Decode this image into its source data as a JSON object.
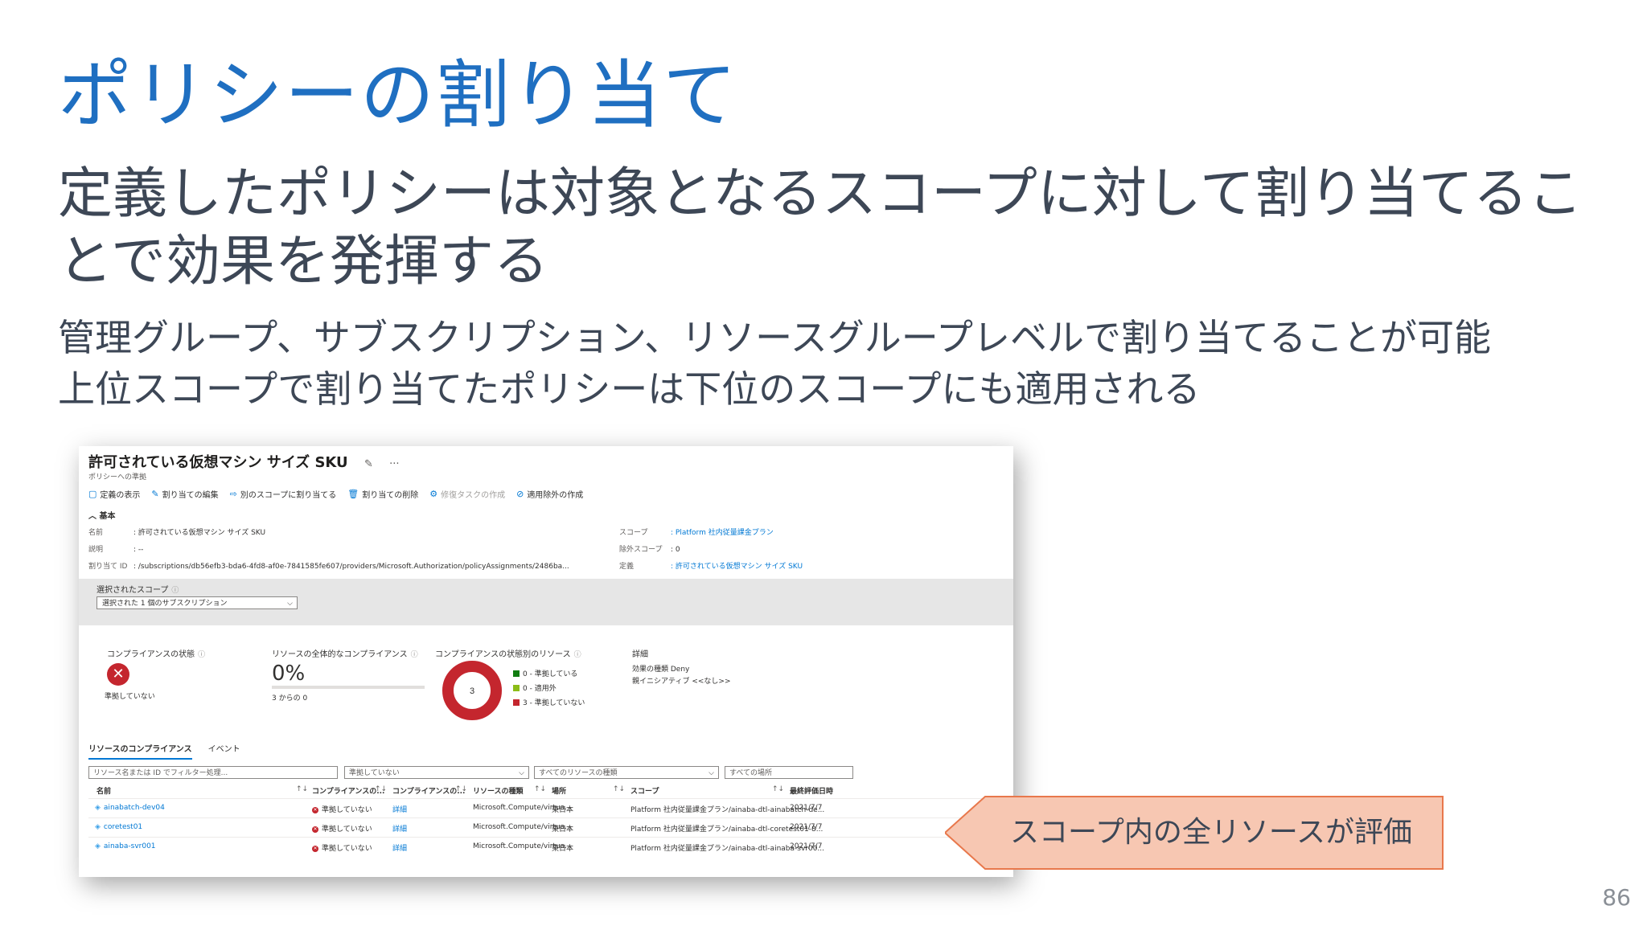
{
  "slide": {
    "title": "ポリシーの割り当て",
    "lead": "定義したポリシーは対象となるスコープに対して割り当てることで効果を発揮する",
    "bullet1": "管理グループ、サブスクリプション、リソースグループレベルで割り当てることが可能",
    "bullet2": "上位スコープで割り当てたポリシーは下位のスコープにも適用される",
    "page_number": "86",
    "callout": "スコープ内の全リソースが評価"
  },
  "panel": {
    "title": "許可されている仮想マシン サイズ SKU",
    "subtitle": "ポリシーへの準拠",
    "toolbar": [
      "定義の表示",
      "割り当ての編集",
      "別のスコープに割り当てる",
      "割り当ての削除",
      "修復タスクの作成",
      "適用除外の作成"
    ],
    "essentials_label": "基本",
    "name_key": "名前",
    "name_val": ": 許可されている仮想マシン サイズ SKU",
    "desc_key": "説明",
    "desc_val": ": --",
    "assign_key": "割り当て ID",
    "assign_val": ": /subscriptions/db56efb3-bda6-4fd8-af0e-7841585fe607/providers/Microsoft.Authorization/policyAssignments/2486ba...",
    "scope_key": "スコープ",
    "scope_val": ": Platform 社内従量課金プラン",
    "excl_key": "除外スコープ",
    "excl_val": ": 0",
    "def_key": "定義",
    "def_val": ": 許可されている仮想マシン サイズ SKU",
    "selected_scope_label": "選択されたスコープ",
    "selected_scope_value": "選択された 1 個のサブスクリプション",
    "compliance_state_label": "コンプライアンスの状態",
    "compliance_state_value": "準拠していない",
    "overall_label": "リソースの全体的なコンプライアンス",
    "overall_pct": "0%",
    "overall_of": "3 からの 0",
    "by_state_label": "コンプライアンスの状態別のリソース",
    "donut_total": "3",
    "legend": [
      "0 - 準拠している",
      "0 - 適用外",
      "3 - 準拠していない"
    ],
    "details_label": "詳細",
    "effect_line": "効果の種類 Deny",
    "parent_line": "親イニシアティブ <<なし>>",
    "tab_resources": "リソースのコンプライアンス",
    "tab_events": "イベント",
    "filter_search": "リソース名または ID でフィルター処理...",
    "filter_state": "準拠していない",
    "filter_type": "すべてのリソースの種類",
    "filter_location": "すべての場所",
    "col_name": "名前",
    "col_state": "コンプライアンスの...",
    "col_state2": "コンプライアンスの...",
    "col_type": "リソースの種類",
    "col_loc": "場所",
    "col_scope": "スコープ",
    "col_date": "最終評価日時",
    "rows": [
      {
        "name": "ainabatch-dev04",
        "state": "準拠していない",
        "detail": "詳細",
        "type": "Microsoft.Compute/virtua...",
        "loc": "東日本",
        "scope": "Platform 社内従量課金プラン/ainaba-dtl-ainabatch-de...",
        "date": "2021/7/7"
      },
      {
        "name": "coretest01",
        "state": "準拠していない",
        "detail": "詳細",
        "type": "Microsoft.Compute/virtua...",
        "loc": "東日本",
        "scope": "Platform 社内従量課金プラン/ainaba-dtl-coretest01-8...",
        "date": "2021/7/7"
      },
      {
        "name": "ainaba-svr001",
        "state": "準拠していない",
        "detail": "詳細",
        "type": "Microsoft.Compute/virtua...",
        "loc": "東日本",
        "scope": "Platform 社内従量課金プラン/ainaba-dtl-ainaba-svr00...",
        "date": "2021/7/7"
      }
    ],
    "colors": {
      "noncompliant": "#c4262e",
      "compliant": "#107c10",
      "exempt": "#8cbd18",
      "link": "#0078d4"
    },
    "icons": [
      "pin-icon",
      "more-icon",
      "info-icon",
      "close-circle-icon",
      "sort-icon",
      "vm-icon"
    ]
  }
}
